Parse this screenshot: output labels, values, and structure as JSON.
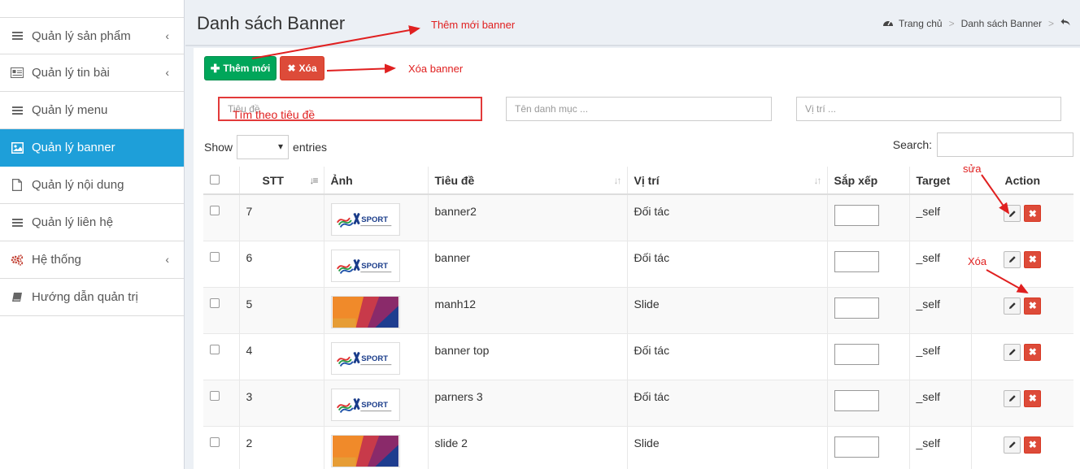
{
  "sidebar": {
    "items": [
      {
        "label": "Quản lý sản phẩm",
        "icon": "bars-icon",
        "chevron": "‹"
      },
      {
        "label": "Quản lý tin bài",
        "icon": "newspaper-icon",
        "chevron": "‹"
      },
      {
        "label": "Quản lý menu",
        "icon": "bars-icon",
        "chevron": ""
      },
      {
        "label": "Quản lý banner",
        "icon": "image-icon",
        "chevron": "",
        "active": true
      },
      {
        "label": "Quản lý nội dung",
        "icon": "file-icon",
        "chevron": ""
      },
      {
        "label": "Quản lý liên hệ",
        "icon": "bars-icon",
        "chevron": ""
      },
      {
        "label": "Hệ thống",
        "icon": "cogs-icon",
        "chevron": "‹"
      },
      {
        "label": "Hướng dẫn quản trị",
        "icon": "book-icon",
        "chevron": ""
      }
    ]
  },
  "header": {
    "title": "Danh sách Banner",
    "breadcrumb": {
      "home": "Trang chủ",
      "current": "Danh sách Banner",
      "sep": ">"
    }
  },
  "toolbar": {
    "add_label": "Thêm mới",
    "delete_label": "Xóa"
  },
  "filters": {
    "title_placeholder": "Tiêu đề",
    "category_placeholder": "Tên danh mục ...",
    "position_placeholder": "Vị trí ..."
  },
  "list_controls": {
    "show_label": "Show",
    "entries_label": "entries",
    "search_label": "Search:"
  },
  "table": {
    "headers": [
      "STT",
      "Ảnh",
      "Tiêu đề",
      "Vị trí",
      "Sắp xếp",
      "Target",
      "Action"
    ],
    "rows": [
      {
        "stt": "7",
        "image": "xsport",
        "title": "banner2",
        "position": "Đối tác",
        "target": "_self"
      },
      {
        "stt": "6",
        "image": "xsport",
        "title": "banner",
        "position": "Đối tác",
        "target": "_self"
      },
      {
        "stt": "5",
        "image": "fabric",
        "title": "manh12",
        "position": "Slide",
        "target": "_self"
      },
      {
        "stt": "4",
        "image": "xsport",
        "title": "banner top",
        "position": "Đối tác",
        "target": "_self"
      },
      {
        "stt": "3",
        "image": "xsport",
        "title": "parners 3",
        "position": "Đối tác",
        "target": "_self"
      },
      {
        "stt": "2",
        "image": "fabric",
        "title": "slide 2",
        "position": "Slide",
        "target": "_self"
      }
    ]
  },
  "annotations": {
    "add": "Thêm mới banner",
    "delete": "Xóa banner",
    "search": "Tìm theo tiêu đề",
    "edit": "sửa",
    "delete_row": "Xóa"
  },
  "colors": {
    "accent": "#1e9fd9",
    "add_button": "#00a65a",
    "delete_button": "#dd4b39",
    "annotation": "#e02020"
  }
}
